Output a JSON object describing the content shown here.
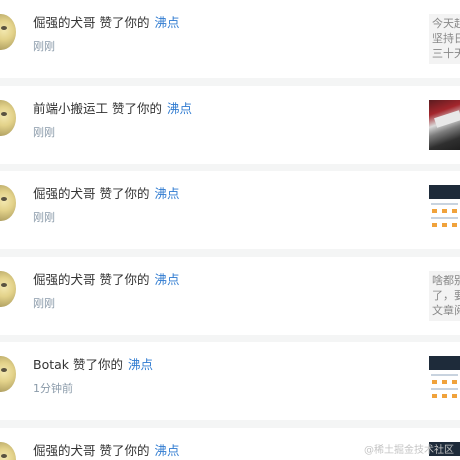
{
  "notifications": [
    {
      "user": "倔强的犬哥",
      "action": "赞了你的",
      "target": "沸点",
      "time": "刚刚",
      "thumb_type": "text",
      "thumb_text": [
        "今天起",
        "坚持日",
        "三十天"
      ]
    },
    {
      "user": "前端小搬运工",
      "action": "赞了你的",
      "target": "沸点",
      "time": "刚刚",
      "thumb_type": "photo-red"
    },
    {
      "user": "倔强的犬哥",
      "action": "赞了你的",
      "target": "沸点",
      "time": "刚刚",
      "thumb_type": "screen"
    },
    {
      "user": "倔强的犬哥",
      "action": "赞了你的",
      "target": "沸点",
      "time": "刚刚",
      "thumb_type": "text",
      "thumb_text": [
        "啥都别",
        "了，要",
        "文章阅"
      ]
    },
    {
      "user": "Botak",
      "action": "赞了你的",
      "target": "沸点",
      "time": "1分钟前",
      "thumb_type": "screen"
    },
    {
      "user": "倔强的犬哥",
      "action": "赞了你的",
      "target": "沸点",
      "time": "",
      "thumb_type": "screen"
    }
  ],
  "watermark": "@稀土掘金技术社区",
  "colors": {
    "link": "#2e7ad0",
    "meta": "#8a9aa9",
    "background": "#f4f5f5"
  }
}
